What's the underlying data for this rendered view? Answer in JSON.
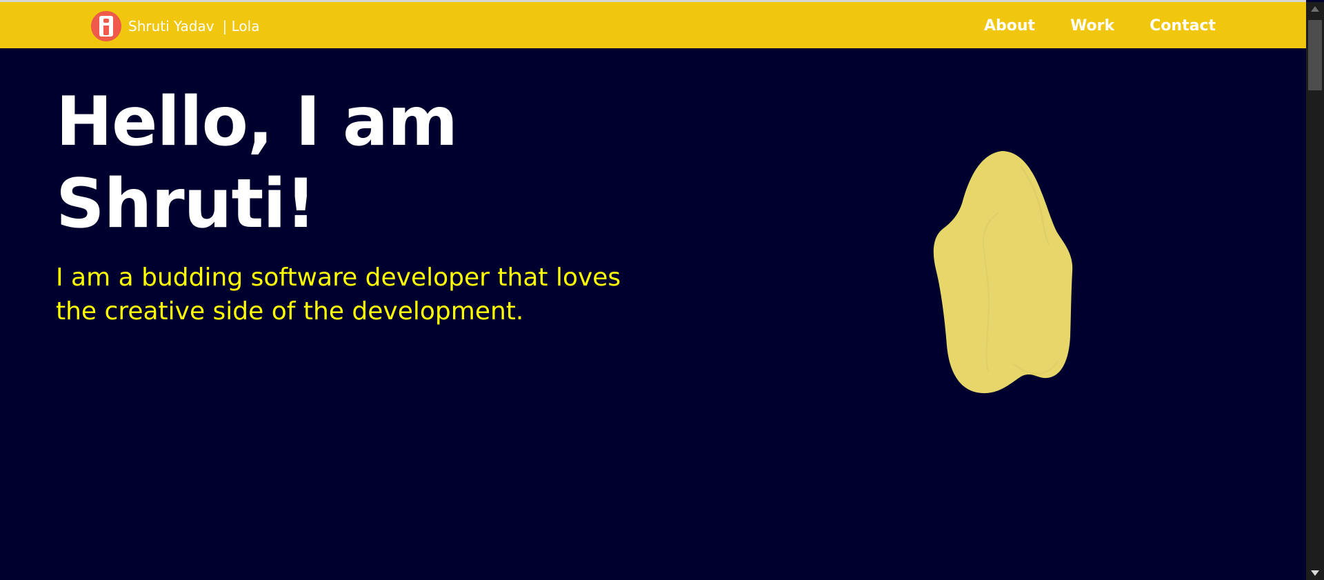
{
  "header": {
    "brand_name": "Shruti Yadav",
    "brand_suffix": "| Lola",
    "nav": {
      "about": "About",
      "work": "Work",
      "contact": "Contact"
    }
  },
  "hero": {
    "title_line1": "Hello, I am",
    "title_line2": "Shruti!",
    "subtitle": "I am a budding software developer that loves the creative side of the development."
  },
  "theme": {
    "header_bg": "#f0c60f",
    "page_bg": "#00002e",
    "title_color": "#ffffff",
    "subtitle_color": "#ffff00",
    "blob_color": "#e7d66a",
    "logo_color": "#f05a4b"
  },
  "icons": {
    "logo": "brand-logo-icon",
    "scroll_up": "chevron-up-icon",
    "scroll_down": "chevron-down-icon",
    "decorative_shape": "yellow-blob-illustration"
  }
}
